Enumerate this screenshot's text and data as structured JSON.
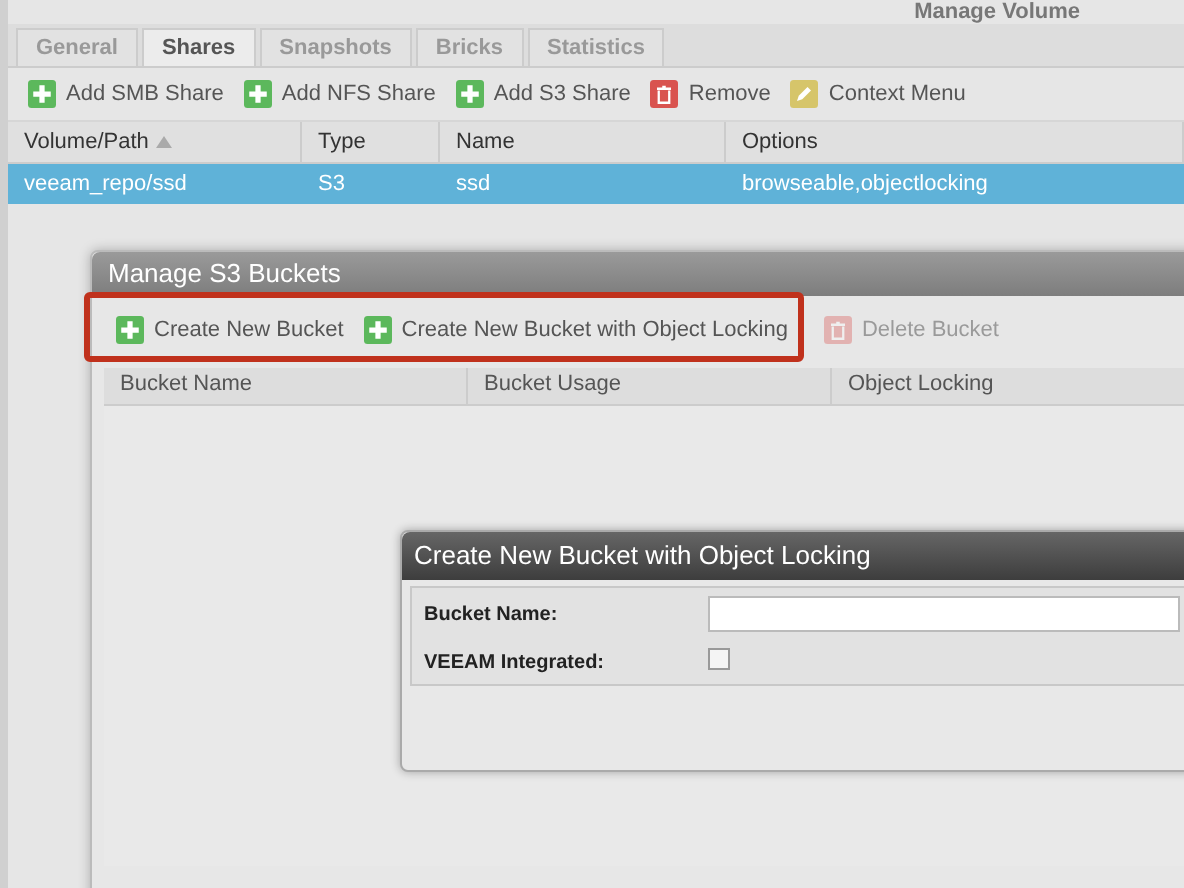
{
  "volume_window": {
    "title": "Manage Volume",
    "tabs": [
      {
        "label": "General",
        "selected": false
      },
      {
        "label": "Shares",
        "selected": true
      },
      {
        "label": "Snapshots",
        "selected": false
      },
      {
        "label": "Bricks",
        "selected": false
      },
      {
        "label": "Statistics",
        "selected": false
      }
    ],
    "toolbar": [
      {
        "label": "Add SMB Share",
        "kind": "add"
      },
      {
        "label": "Add NFS Share",
        "kind": "add"
      },
      {
        "label": "Add S3 Share",
        "kind": "add"
      },
      {
        "label": "Remove",
        "kind": "remove"
      },
      {
        "label": "Context Menu",
        "kind": "edit"
      }
    ],
    "table": {
      "columns": [
        {
          "label": "Volume/Path",
          "sorted": true
        },
        {
          "label": "Type"
        },
        {
          "label": "Name"
        },
        {
          "label": "Options"
        }
      ],
      "rows": [
        {
          "cells": [
            "veeam_repo/ssd",
            "S3",
            "ssd",
            "browseable,objectlocking"
          ],
          "selected": true
        }
      ]
    }
  },
  "buckets_window": {
    "title": "Manage S3 Buckets",
    "toolbar": [
      {
        "label": "Create New Bucket",
        "kind": "add",
        "disabled": false
      },
      {
        "label": "Create New Bucket with Object Locking",
        "kind": "add",
        "disabled": false
      },
      {
        "label": "Delete Bucket",
        "kind": "remove",
        "disabled": true
      }
    ],
    "columns": [
      "Bucket Name",
      "Bucket Usage",
      "Object Locking"
    ]
  },
  "dialog": {
    "title": "Create New Bucket with Object Locking",
    "fields": [
      {
        "label": "Bucket Name:",
        "kind": "text"
      },
      {
        "label": "VEEAM Integrated:",
        "kind": "checkbox",
        "checked": false
      }
    ]
  }
}
